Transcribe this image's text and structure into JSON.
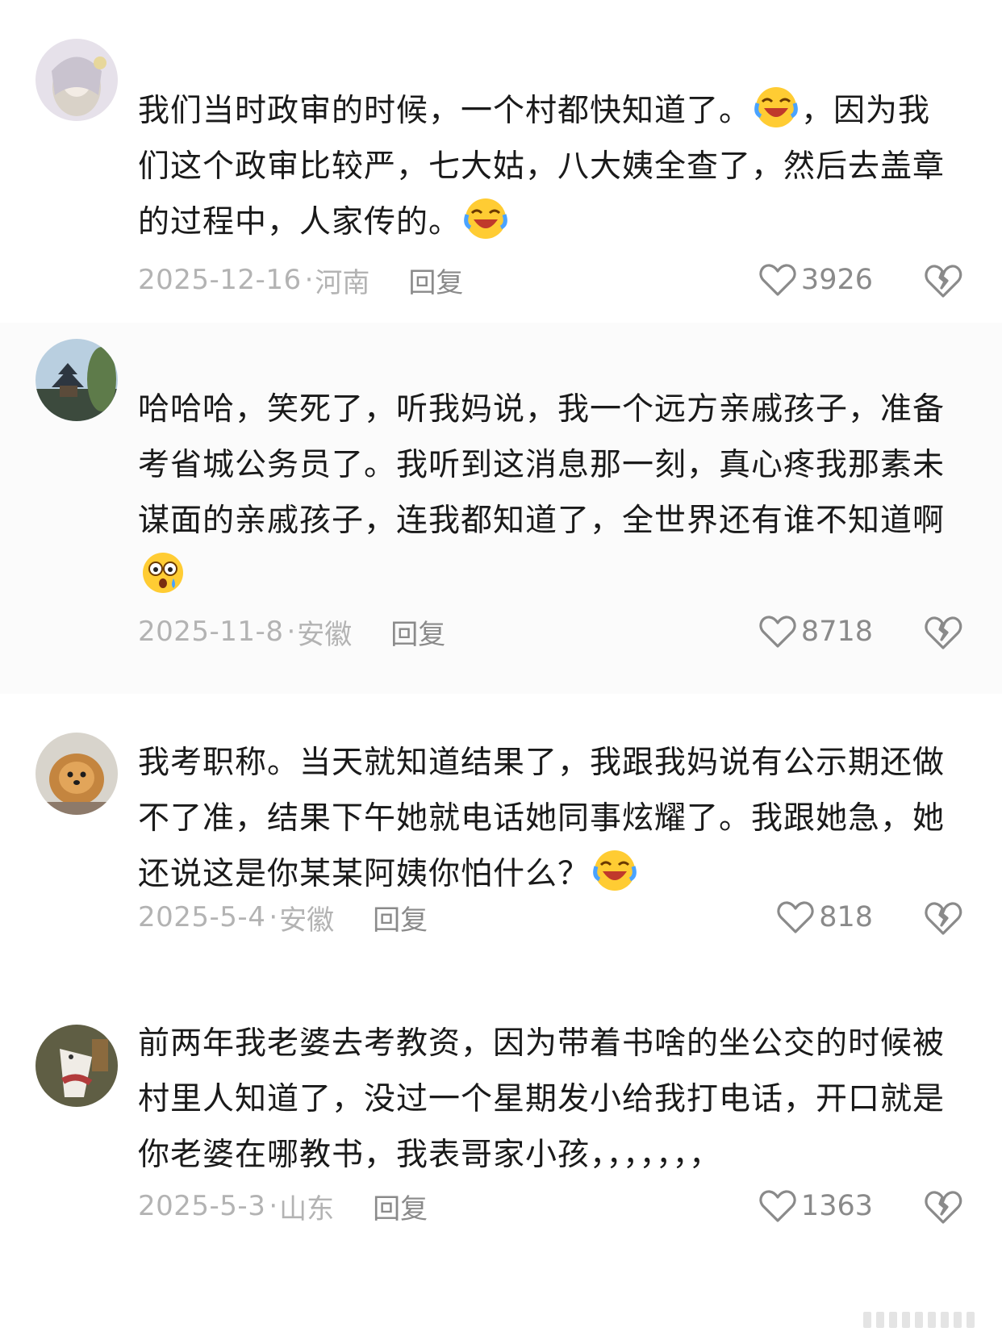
{
  "comments": [
    {
      "text_parts": [
        "我们当时政审的时候，一个村都快知道了。",
        "，因为我们这个政审比较严，七大姑，八大姨全查了，然后去盖章的过程中，人家传的。",
        ""
      ],
      "emojis": [
        "laugh-cry-emoji",
        "laugh-cry-emoji"
      ],
      "date": "2025-12-16",
      "location": "河南",
      "reply": "回复",
      "likes": "3926"
    },
    {
      "text_parts": [
        "哈哈哈，笑死了，听我妈说，我一个远方亲戚孩子，准备考省城公务员了。我听到这消息那一刻，真心疼我那素未谋面的亲戚孩子，连我都知道了，全世界还有谁不知道啊"
      ],
      "emojis": [
        "shocked-emoji"
      ],
      "date": "2025-11-8",
      "location": "安徽",
      "reply": "回复",
      "likes": "8718"
    },
    {
      "text_parts": [
        "我考职称。当天就知道结果了，我跟我妈说有公示期还做不了准，结果下午她就电话她同事炫耀了。我跟她急，她还说这是你某某阿姨你怕什么？"
      ],
      "emojis": [
        "laugh-cry-emoji"
      ],
      "date": "2025-5-4",
      "location": "安徽",
      "reply": "回复",
      "likes": "818"
    },
    {
      "text_parts": [
        "前两年我老婆去考教资，因为带着书啥的坐公交的时候被村里人知道了，没过一个星期发小给我打电话，开口就是你老婆在哪教书，我表哥家小孩，，，，，，，"
      ],
      "emojis": [],
      "date": "2025-5-3",
      "location": "山东",
      "reply": "回复",
      "likes": "1363"
    }
  ],
  "colors": {
    "text": "#1a1a1a",
    "meta": "#b3b3b3",
    "reply": "#8a8a8a",
    "icon": "#8a8a8a"
  },
  "icons": [
    "heart-icon",
    "broken-heart-icon"
  ],
  "watermark_text": "微博"
}
